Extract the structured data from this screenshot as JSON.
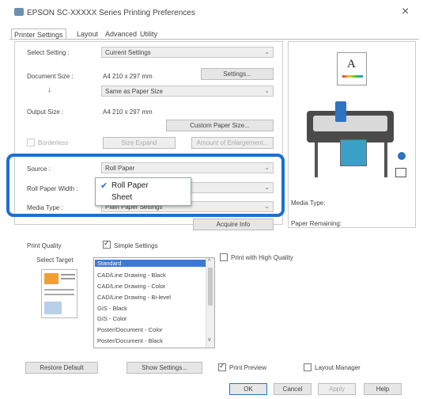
{
  "window": {
    "title": "EPSON SC-XXXXX Series Printing Preferences",
    "close": "×"
  },
  "tabs": [
    "Printer Settings",
    "Layout",
    "Advanced",
    "Utility"
  ],
  "main": {
    "select_setting": {
      "label": "Select Setting :",
      "value": "Current Settings"
    },
    "document_size": {
      "label": "Document Size :",
      "value": "A4 210 x 297 mm",
      "settings_btn": "Settings...",
      "arrow": "↓",
      "same_as": "Same as Paper Size"
    },
    "output_size": {
      "label": "Output Size :",
      "value": "A4 210 x 297 mm",
      "custom_btn": "Custom Paper Size..."
    },
    "borderless": {
      "label": "Borderless",
      "size_btn": "Size Expand",
      "amount_btn": "Amount of Enlargement..."
    },
    "source": {
      "label": "Source :",
      "value": "Roll Paper"
    },
    "roll_width": {
      "label": "Roll Paper Width :"
    },
    "media_type": {
      "label": "Media Type :",
      "value": "Plain Paper Settings"
    },
    "source_options": [
      "Roll Paper",
      "Sheet"
    ],
    "acquire_btn": "Acquire Info",
    "print_quality": {
      "label": "Print Quality",
      "simple": "Simple Settings",
      "select_target": "Select Target",
      "high_quality": "Print with High Quality"
    },
    "targets": [
      "Standard",
      "CAD/Line Drawing - Black",
      "CAD/Line Drawing - Color",
      "CAD/Line Drawing - Bi-level",
      "GIS - Black",
      "GIS - Color",
      "Poster/Document - Color",
      "Poster/Document - Black"
    ]
  },
  "right": {
    "media_type": "Media Type:",
    "paper_remaining": "Paper Remaining:",
    "preview_letter": "A"
  },
  "bottom": {
    "restore": "Restore Default",
    "show_settings": "Show Settings...",
    "print_preview": "Print Preview",
    "layout_manager": "Layout Manager"
  },
  "footer": {
    "ok": "OK",
    "cancel": "Cancel",
    "apply": "Apply",
    "help": "Help"
  }
}
